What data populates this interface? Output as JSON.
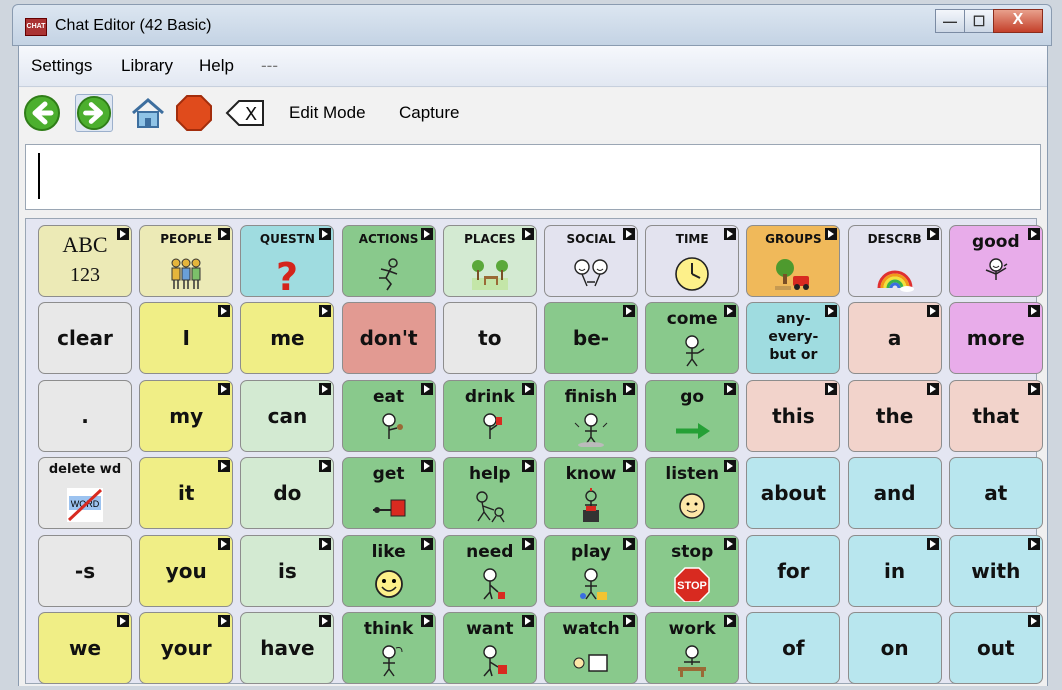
{
  "window": {
    "app_icon": "CHAT",
    "title": "Chat Editor (42 Basic)",
    "controls": {
      "minimize": "—",
      "maximize": "☐",
      "close": "X"
    }
  },
  "menu": [
    "Settings",
    "Library",
    "Help",
    "---"
  ],
  "toolbar": {
    "back_icon": "back-arrow-icon",
    "forward_icon": "forward-arrow-icon",
    "home_icon": "home-icon",
    "stop_icon": "stop-icon",
    "clear_icon": "clear-x-icon",
    "clear_glyph": "X",
    "edit_mode": "Edit Mode",
    "capture": "Capture"
  },
  "message_box": {
    "value": ""
  },
  "colors": {
    "white": "#e8e8e8",
    "yellow": "#f0ee86",
    "lightgreen": "#d3ead2",
    "green": "#89c98c",
    "pink": "#f2d3cb",
    "purple": "#e8acea",
    "cyan": "#9fdce0",
    "red": "#e29a92",
    "blue": "#b8e6ee",
    "cream": "#eceab6",
    "orange": "#f0b95a",
    "lavender": "#e3e3ef"
  },
  "rows": [
    [
      {
        "label": "ABC",
        "label2": "123",
        "color": "cream",
        "kind": "abc",
        "flag": true
      },
      {
        "label": "PEOPLE",
        "color": "cream",
        "kind": "cat",
        "icon": "people-icon",
        "flag": true
      },
      {
        "label": "QUESTN",
        "color": "cyan",
        "kind": "cat",
        "icon": "question-icon",
        "flag": true
      },
      {
        "label": "ACTIONS",
        "color": "green",
        "kind": "cat",
        "icon": "running-person-icon",
        "flag": true
      },
      {
        "label": "PLACES",
        "color": "lightgreen",
        "kind": "cat",
        "icon": "park-icon",
        "flag": true
      },
      {
        "label": "SOCIAL",
        "color": "lavender",
        "kind": "cat",
        "icon": "faces-icon",
        "flag": true
      },
      {
        "label": "TIME",
        "color": "lavender",
        "kind": "cat",
        "icon": "clock-icon",
        "flag": true
      },
      {
        "label": "GROUPS",
        "color": "orange",
        "kind": "cat",
        "icon": "groups-icon",
        "flag": true
      },
      {
        "label": "DESCRB",
        "color": "lavender",
        "kind": "cat",
        "icon": "rainbow-icon",
        "flag": true
      },
      {
        "label": "good",
        "color": "purple",
        "kind": "word-pic",
        "icon": "good-icon",
        "flag": true
      }
    ],
    [
      {
        "label": "clear",
        "color": "white",
        "kind": "word",
        "flag": false
      },
      {
        "label": "I",
        "color": "yellow",
        "kind": "word",
        "flag": true
      },
      {
        "label": "me",
        "color": "yellow",
        "kind": "word",
        "flag": true
      },
      {
        "label": "don't",
        "color": "red",
        "kind": "word",
        "flag": false
      },
      {
        "label": "to",
        "color": "white",
        "kind": "word",
        "flag": false
      },
      {
        "label": "be-",
        "color": "green",
        "kind": "word",
        "flag": true
      },
      {
        "label": "come",
        "color": "green",
        "kind": "word-pic",
        "icon": "come-icon",
        "flag": true
      },
      {
        "label": "any- every- but or",
        "color": "cyan",
        "kind": "small",
        "flag": true
      },
      {
        "label": "a",
        "color": "pink",
        "kind": "word",
        "flag": true
      },
      {
        "label": "more",
        "color": "purple",
        "kind": "word",
        "flag": true
      }
    ],
    [
      {
        "label": ".",
        "color": "white",
        "kind": "word",
        "flag": false
      },
      {
        "label": "my",
        "color": "yellow",
        "kind": "word",
        "flag": true
      },
      {
        "label": "can",
        "color": "lightgreen",
        "kind": "word",
        "flag": true
      },
      {
        "label": "eat",
        "color": "green",
        "kind": "word-pic",
        "icon": "eat-icon",
        "flag": true
      },
      {
        "label": "drink",
        "color": "green",
        "kind": "word-pic",
        "icon": "drink-icon",
        "flag": true
      },
      {
        "label": "finish",
        "color": "green",
        "kind": "word-pic",
        "icon": "finish-icon",
        "flag": true
      },
      {
        "label": "go",
        "color": "green",
        "kind": "word-pic",
        "icon": "go-arrow-icon",
        "flag": true
      },
      {
        "label": "this",
        "color": "pink",
        "kind": "word",
        "flag": true
      },
      {
        "label": "the",
        "color": "pink",
        "kind": "word",
        "flag": true
      },
      {
        "label": "that",
        "color": "pink",
        "kind": "word",
        "flag": true
      }
    ],
    [
      {
        "label": "delete wd",
        "label2": "WORD",
        "color": "white",
        "kind": "delete",
        "icon": "delete-word-icon",
        "flag": false
      },
      {
        "label": "it",
        "color": "yellow",
        "kind": "word",
        "flag": true
      },
      {
        "label": "do",
        "color": "lightgreen",
        "kind": "word",
        "flag": true
      },
      {
        "label": "get",
        "color": "green",
        "kind": "word-pic",
        "icon": "get-icon",
        "flag": true
      },
      {
        "label": "help",
        "color": "green",
        "kind": "word-pic",
        "icon": "help-icon",
        "flag": true
      },
      {
        "label": "know",
        "color": "green",
        "kind": "word-pic",
        "icon": "know-icon",
        "flag": true
      },
      {
        "label": "listen",
        "color": "green",
        "kind": "word-pic",
        "icon": "listen-icon",
        "flag": true
      },
      {
        "label": "about",
        "color": "blue",
        "kind": "word",
        "flag": false
      },
      {
        "label": "and",
        "color": "blue",
        "kind": "word",
        "flag": false
      },
      {
        "label": "at",
        "color": "blue",
        "kind": "word",
        "flag": false
      }
    ],
    [
      {
        "label": "-s",
        "color": "white",
        "kind": "word",
        "flag": false
      },
      {
        "label": "you",
        "color": "yellow",
        "kind": "word",
        "flag": true
      },
      {
        "label": "is",
        "color": "lightgreen",
        "kind": "word",
        "flag": true
      },
      {
        "label": "like",
        "color": "green",
        "kind": "word-pic",
        "icon": "like-icon",
        "flag": true
      },
      {
        "label": "need",
        "color": "green",
        "kind": "word-pic",
        "icon": "need-icon",
        "flag": true
      },
      {
        "label": "play",
        "color": "green",
        "kind": "word-pic",
        "icon": "play-icon",
        "flag": true
      },
      {
        "label": "stop",
        "color": "green",
        "kind": "word-pic",
        "icon": "stop-sign-icon",
        "sign": "STOP",
        "flag": true
      },
      {
        "label": "for",
        "color": "blue",
        "kind": "word",
        "flag": false
      },
      {
        "label": "in",
        "color": "blue",
        "kind": "word",
        "flag": true
      },
      {
        "label": "with",
        "color": "blue",
        "kind": "word",
        "flag": true
      }
    ],
    [
      {
        "label": "we",
        "color": "yellow",
        "kind": "word",
        "flag": true
      },
      {
        "label": "your",
        "color": "yellow",
        "kind": "word",
        "flag": true
      },
      {
        "label": "have",
        "color": "lightgreen",
        "kind": "word",
        "flag": true
      },
      {
        "label": "think",
        "color": "green",
        "kind": "word-pic",
        "icon": "think-icon",
        "flag": true
      },
      {
        "label": "want",
        "color": "green",
        "kind": "word-pic",
        "icon": "want-icon",
        "flag": true
      },
      {
        "label": "watch",
        "color": "green",
        "kind": "word-pic",
        "icon": "watch-icon",
        "flag": true
      },
      {
        "label": "work",
        "color": "green",
        "kind": "word-pic",
        "icon": "work-icon",
        "flag": true
      },
      {
        "label": "of",
        "color": "blue",
        "kind": "word",
        "flag": false
      },
      {
        "label": "on",
        "color": "blue",
        "kind": "word",
        "flag": false
      },
      {
        "label": "out",
        "color": "blue",
        "kind": "word",
        "flag": true
      }
    ]
  ]
}
